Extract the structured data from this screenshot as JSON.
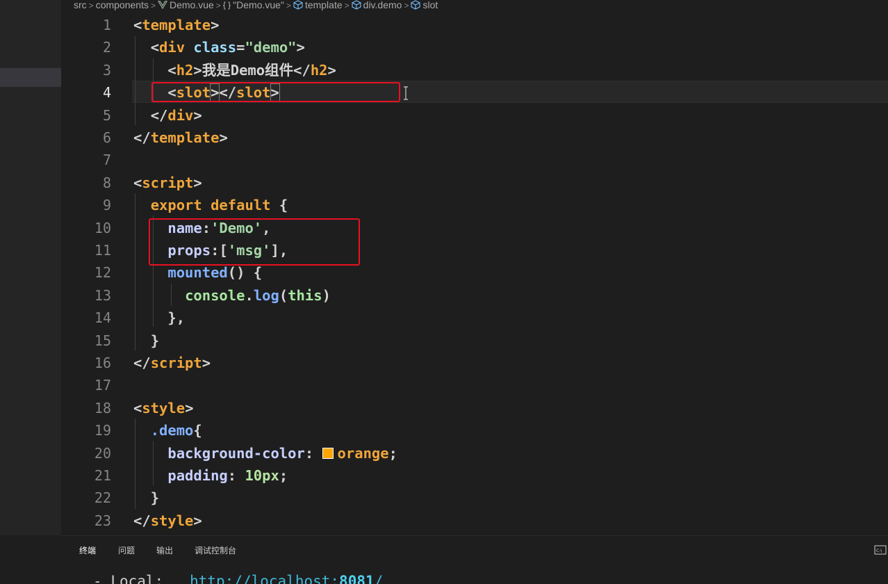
{
  "breadcrumb": {
    "items": [
      {
        "label": "src",
        "icon": ""
      },
      {
        "label": "components",
        "icon": ""
      },
      {
        "label": "Demo.vue",
        "icon": "vue-icon"
      },
      {
        "label": "\"Demo.vue\"",
        "icon": "braces-icon"
      },
      {
        "label": "template",
        "icon": "cube-icon"
      },
      {
        "label": "div.demo",
        "icon": "cube-icon"
      },
      {
        "label": "slot",
        "icon": "cube-icon"
      }
    ],
    "separator": ">"
  },
  "editor": {
    "active_line": 4,
    "line_numbers": [
      "1",
      "2",
      "3",
      "4",
      "5",
      "6",
      "7",
      "8",
      "9",
      "10",
      "11",
      "12",
      "13",
      "14",
      "15",
      "16",
      "17",
      "18",
      "19",
      "20",
      "21",
      "22",
      "23"
    ],
    "code": {
      "l1": {
        "lt": "<",
        "tag": "template",
        "gt": ">"
      },
      "l2": {
        "lt": "<",
        "tag": "div",
        "attr": "class",
        "eq": "=",
        "str": "\"demo\"",
        "gt": ">"
      },
      "l3": {
        "open": "<",
        "tag": "h2",
        "gt": ">",
        "text": "我是Demo组件",
        "close": "</",
        "tag2": "h2",
        "gt2": ">"
      },
      "l4": {
        "open": "<",
        "tag": "slot",
        "gt": ">",
        "close": "</",
        "tag2": "slot",
        "gt2": ">"
      },
      "l5": {
        "close": "</",
        "tag": "div",
        "gt": ">"
      },
      "l6": {
        "close": "</",
        "tag": "template",
        "gt": ">"
      },
      "l8": {
        "lt": "<",
        "tag": "script",
        "gt": ">"
      },
      "l9": {
        "kw1": "export",
        "kw2": "default",
        "brace": "{"
      },
      "l10": {
        "prop": "name",
        "colon": ":",
        "str": "'Demo'",
        "comma": ","
      },
      "l11": {
        "prop": "props",
        "colon": ":",
        "open": "[",
        "str": "'msg'",
        "close": "],"
      },
      "l12": {
        "fn": "mounted",
        "rest": "() {"
      },
      "l13": {
        "obj": "console",
        "dot": ".",
        "fn": "log",
        "open": "(",
        "this": "this",
        "close": ")"
      },
      "l14": {
        "text": "},"
      },
      "l15": {
        "text": "}"
      },
      "l16": {
        "close": "</",
        "tag": "script",
        "gt": ">"
      },
      "l18": {
        "lt": "<",
        "tag": "style",
        "gt": ">"
      },
      "l19": {
        "sel": ".demo",
        "brace": "{"
      },
      "l20": {
        "prop": "background-color",
        "colon": ":",
        "val": "orange",
        "semi": ";"
      },
      "l21": {
        "prop": "padding",
        "colon": ":",
        "num": "10px",
        "semi": ";"
      },
      "l22": {
        "text": "}"
      },
      "l23": {
        "close": "</",
        "tag": "style",
        "gt": ">"
      }
    },
    "swatch_color": "#ffa500"
  },
  "panel": {
    "tabs": [
      "终端",
      "问题",
      "输出",
      "调试控制台"
    ],
    "active_tab": "终端"
  },
  "terminal": {
    "bullet": "-",
    "label": "Local:",
    "url": "http://localhost:",
    "port": "8081",
    "slash": "/"
  },
  "colors": {
    "highlight": "#e81123",
    "background": "#1e1e1e",
    "sidebar": "#252526"
  }
}
